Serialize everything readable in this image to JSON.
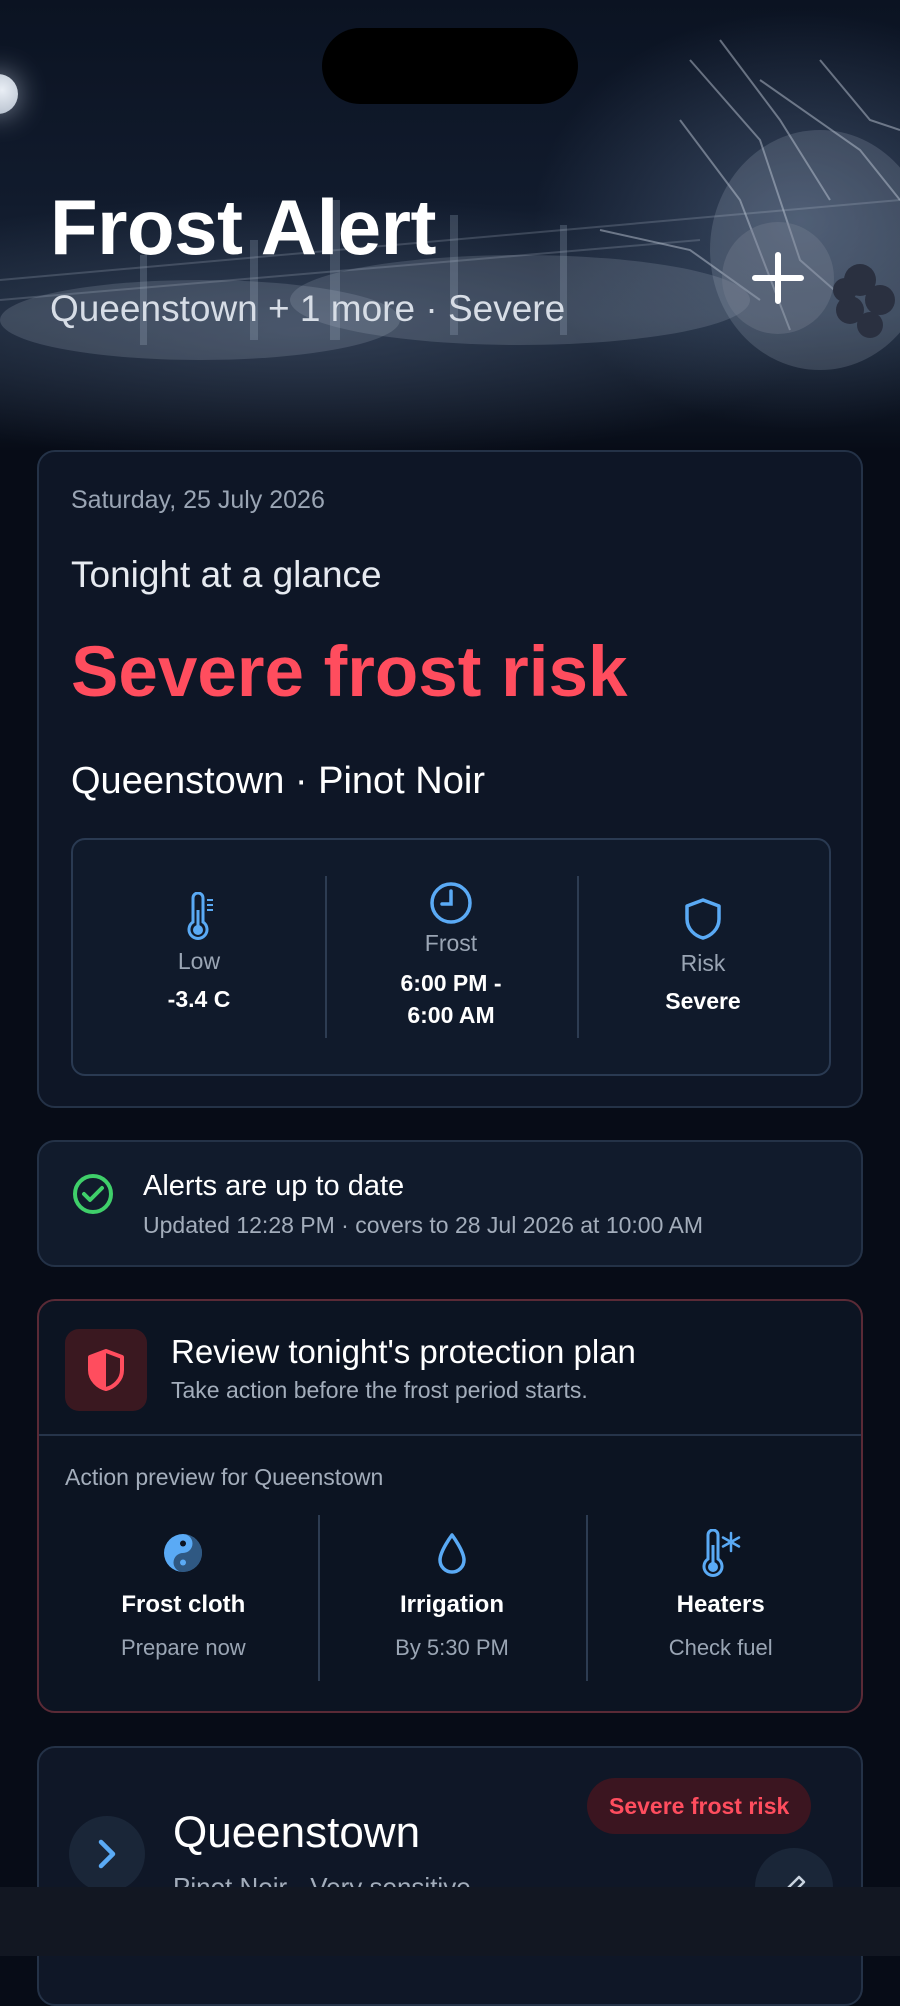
{
  "hero": {
    "title": "Frost Alert",
    "subtitle": "Queenstown + 1 more · Severe",
    "add_icon": "plus-icon"
  },
  "glance": {
    "date": "Saturday, 25 July 2026",
    "label": "Tonight at a glance",
    "headline": "Severe frost risk",
    "place": "Queenstown · Pinot Noir",
    "stats": [
      {
        "icon": "thermometer-icon",
        "label": "Low",
        "value": "-3.4 C"
      },
      {
        "icon": "clock-icon",
        "label": "Frost",
        "value": "6:00 PM - 6:00 AM"
      },
      {
        "icon": "shield-icon",
        "label": "Risk",
        "value": "Severe"
      }
    ]
  },
  "sync": {
    "icon": "check-circle-icon",
    "title": "Alerts are up to date",
    "subtitle": "Updated 12:28 PM · covers to 28 Jul 2026 at 10:00 AM"
  },
  "plan": {
    "icon": "shield-half-icon",
    "title": "Review tonight's protection plan",
    "subtitle": "Take action before the frost period starts.",
    "preview_label": "Action preview for Queenstown",
    "actions": [
      {
        "icon": "frost-cloth-icon",
        "label": "Frost cloth",
        "sub": "Prepare now"
      },
      {
        "icon": "water-drop-icon",
        "label": "Irrigation",
        "sub": "By 5:30 PM"
      },
      {
        "icon": "thermometer-snow-icon",
        "label": "Heaters",
        "sub": "Check fuel"
      }
    ]
  },
  "location": {
    "name": "Queenstown",
    "subtitle": "Pinot Noir · Very sensitive",
    "badge": "Severe frost risk"
  },
  "colors": {
    "background": "#070c17",
    "card": "#0e1626",
    "danger": "#ff4d5e",
    "accent_blue": "#5aaaf5",
    "success": "#3fcf6a"
  }
}
